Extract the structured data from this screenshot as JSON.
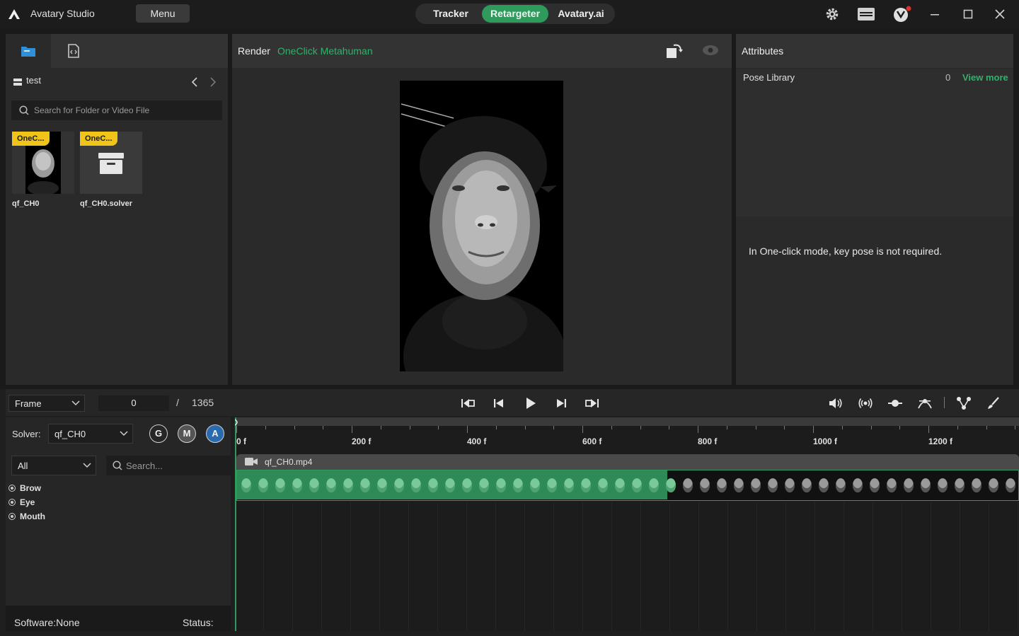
{
  "app": {
    "title": "Avatary Studio",
    "menu_label": "Menu"
  },
  "modes": [
    {
      "label": "Tracker"
    },
    {
      "label": "Retargeter"
    },
    {
      "label": "Avatary.ai"
    }
  ],
  "active_mode": "Retargeter",
  "browser": {
    "path": "test",
    "search_placeholder": "Search for Folder or Video File",
    "files": [
      {
        "badge": "OneC...",
        "name": "qf_CH0",
        "kind": "video"
      },
      {
        "badge": "OneC...",
        "name": "qf_CH0.solver",
        "kind": "solver"
      }
    ]
  },
  "render": {
    "title": "Render",
    "subtitle": "OneClick Metahuman"
  },
  "attributes": {
    "title": "Attributes",
    "pose_library_label": "Pose Library",
    "pose_count": "0",
    "view_more": "View more",
    "message": "In One-click mode, key pose is not required."
  },
  "playback": {
    "mode": "Frame",
    "current_frame": "0",
    "separator": "/",
    "total_frames": "1365"
  },
  "solver": {
    "label": "Solver:",
    "value": "qf_CH0",
    "buttons": [
      "G",
      "M",
      "A"
    ],
    "active_button": "A"
  },
  "filter": {
    "category": "All",
    "search_placeholder": "Search...",
    "categories": [
      "Brow",
      "Eye",
      "Mouth"
    ]
  },
  "status": {
    "software": "Software:None",
    "status": "Status:"
  },
  "timeline": {
    "ticks": [
      {
        "label": "0 f",
        "frame": 0
      },
      {
        "label": "200 f",
        "frame": 200
      },
      {
        "label": "400 f",
        "frame": 400
      },
      {
        "label": "600 f",
        "frame": 600
      },
      {
        "label": "800 f",
        "frame": 800
      },
      {
        "label": "1000 f",
        "frame": 1000
      },
      {
        "label": "1200 f",
        "frame": 1200
      }
    ],
    "clip_name": "qf_CH0.mp4",
    "processed_fraction": 0.55
  },
  "colors": {
    "accent": "#2e9b5c",
    "badge": "#f0c419",
    "link": "#2fb26a",
    "active_circle": "#2a6bb0"
  }
}
